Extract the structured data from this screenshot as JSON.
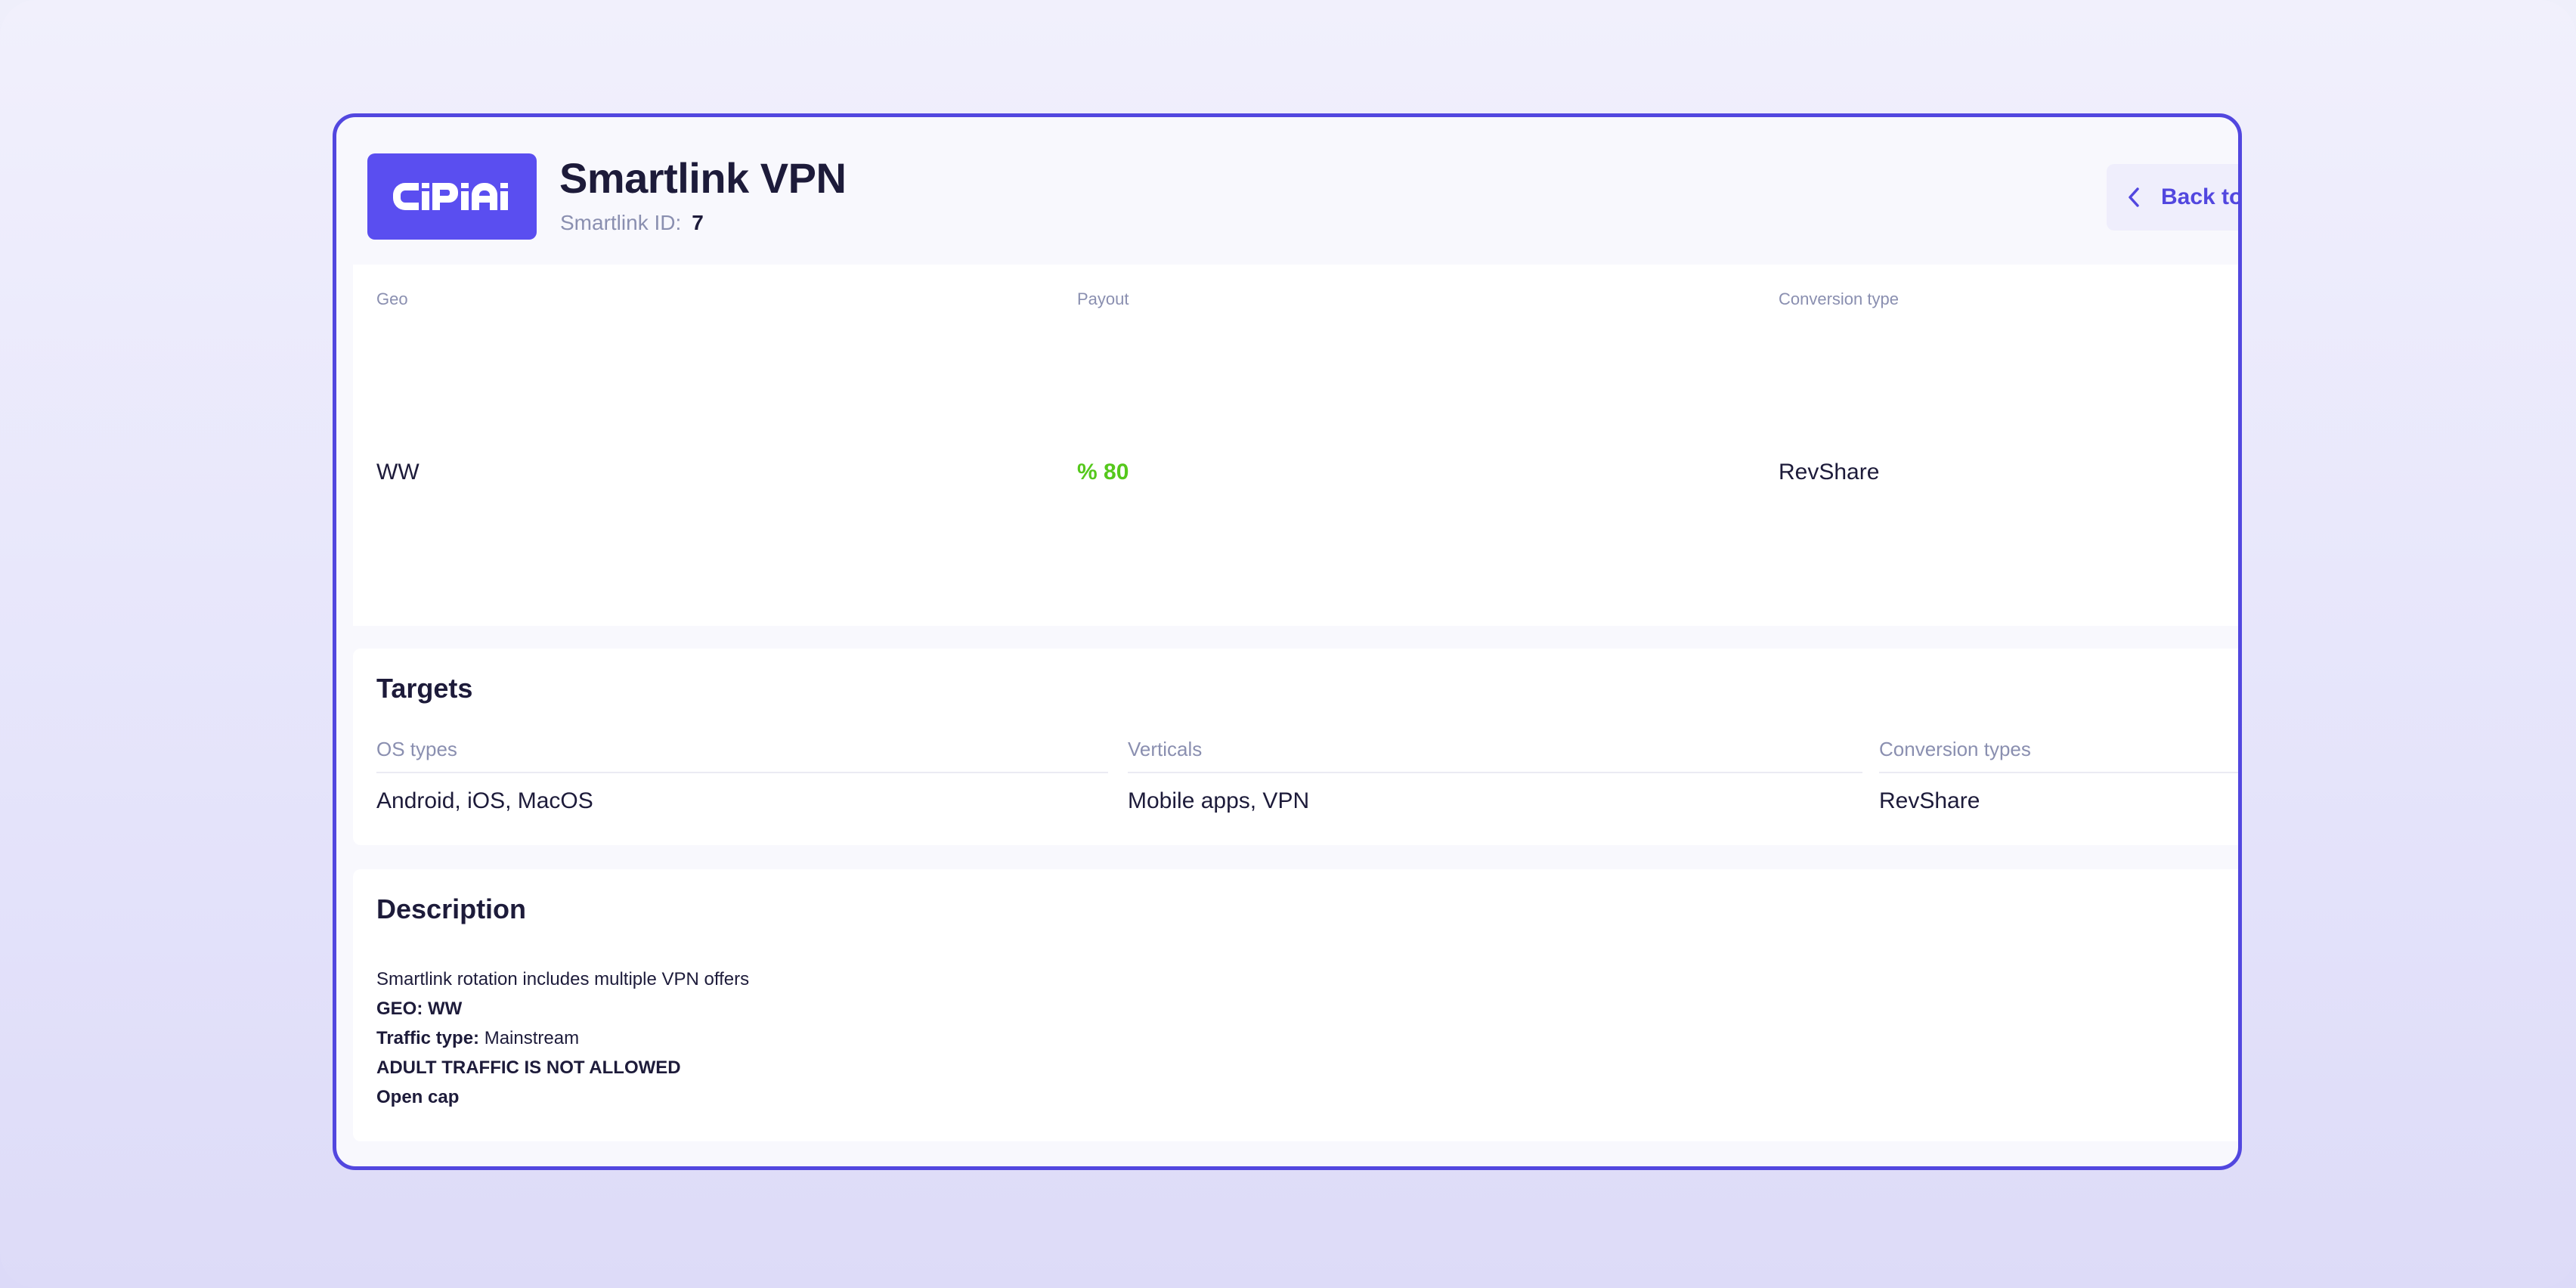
{
  "header": {
    "logo_text": "CiPiAi",
    "title": "Smartlink VPN",
    "id_label": "Smartlink ID:",
    "id_value": "7",
    "back_label": "Back to",
    "brand_color": "#5A4EF0"
  },
  "summary": {
    "geo_label": "Geo",
    "geo_value": "WW",
    "payout_label": "Payout",
    "payout_value": "% 80",
    "conversion_label": "Conversion type",
    "conversion_value": "RevShare",
    "payout_color": "#55C81C"
  },
  "targets": {
    "title": "Targets",
    "os_label": "OS types",
    "os_value": "Android, iOS, MacOS",
    "verticals_label": "Verticals",
    "verticals_value": "Mobile apps, VPN",
    "conversion_types_label": "Conversion types",
    "conversion_types_value": "RevShare"
  },
  "description": {
    "title": "Description",
    "line1": "Smartlink rotation includes multiple VPN offers",
    "line2": "GEO: WW",
    "line3_label": "Traffic type:",
    "line3_value": " Mainstream",
    "line4": "ADULT TRAFFIC IS NOT ALLOWED",
    "line5": "Open cap"
  },
  "icons": {
    "back": "chevron-left-icon",
    "logo": "brand-logo"
  }
}
